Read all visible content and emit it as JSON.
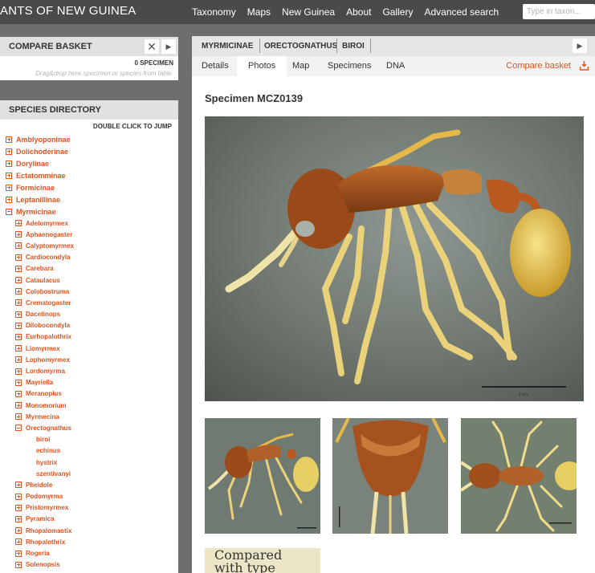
{
  "header": {
    "brand": "ANTS OF NEW GUINEA",
    "nav": [
      "Taxonomy",
      "Maps",
      "New Guinea",
      "About",
      "Gallery",
      "Advanced search"
    ],
    "search_placeholder": "Type in taxon..."
  },
  "compare_basket": {
    "title": "COMPARE BASKET",
    "close_glyph": "✕",
    "play_glyph": "▶",
    "count": "0 SPECIMEN",
    "hint": "Drag&drop here specimen or species from table"
  },
  "species_directory": {
    "title": "SPECIES DIRECTORY",
    "jump_hint": "DOUBLE CLICK TO JUMP",
    "subfamilies": [
      "Amblyoponinae",
      "Dolichoderinae",
      "Dorylinae",
      "Ectatomminae",
      "Formicinae",
      "Leptanillinae",
      "Myrmicinae"
    ],
    "genera": [
      "Adelomyrmex",
      "Aphaenogaster",
      "Calyptomyrmex",
      "Cardiocondyla",
      "Carebara",
      "Cataulacus",
      "Colobostruma",
      "Crematogaster",
      "Dacetinops",
      "Dilobocondyla",
      "Eurhopalothrix",
      "Liomyrmex",
      "Lophomyrmex",
      "Lordomyrma",
      "Mayriella",
      "Meranoplus",
      "Monomorium",
      "Myrmecina",
      "Orectognathus"
    ],
    "species": [
      "biroi",
      "echinus",
      "hystrix",
      "szentivanyi"
    ],
    "genera_after": [
      "Pheidole",
      "Podomyrma",
      "Pristomyrmex",
      "Pyramica",
      "Rhopalomastix",
      "Rhopalothrix",
      "Rogeria",
      "Solenopsis"
    ]
  },
  "breadcrumb": {
    "items": [
      "MYRMICINAE",
      "ORECTOGNATHUS",
      "BIROI"
    ],
    "play_glyph": "▶"
  },
  "tabs": {
    "items": [
      "Details",
      "Photos",
      "Map",
      "Specimens",
      "DNA"
    ],
    "active": "Photos",
    "compare_basket": "Compare basket"
  },
  "specimen": {
    "title": "Specimen MCZ0139",
    "scale_label": "1 mm",
    "label_snippet": "Compared\nwith type"
  },
  "colors": {
    "accent": "#e2531e",
    "topbar": "#4a4a4a",
    "background": "#6e6e6e"
  }
}
